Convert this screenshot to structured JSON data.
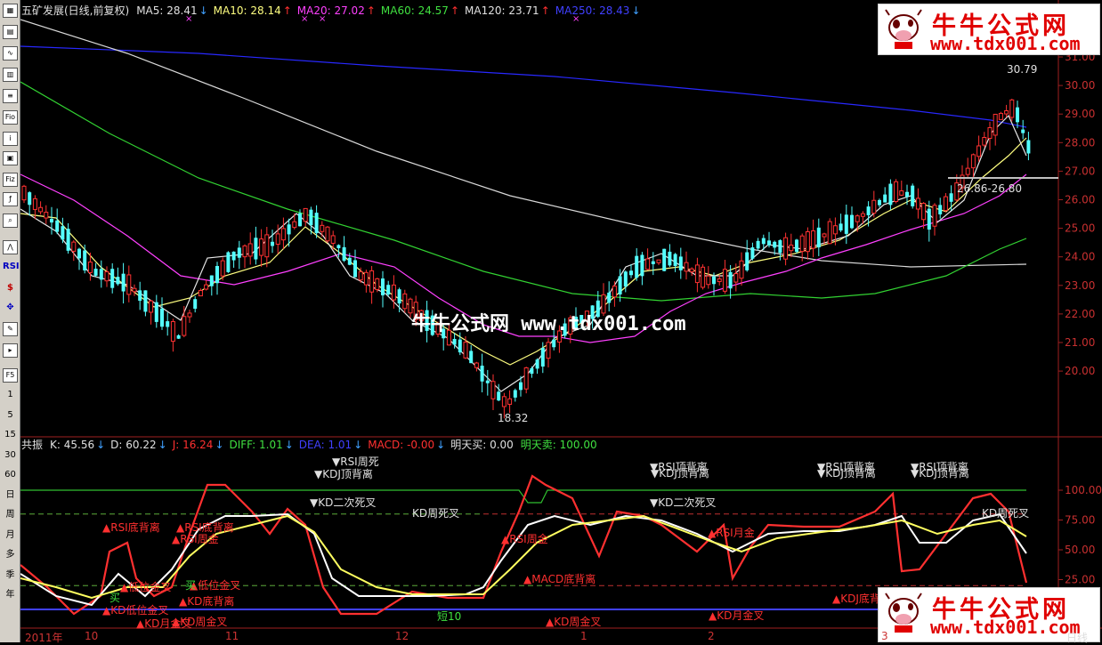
{
  "main_legend": [
    {
      "text": "五矿发展(日线,前复权)",
      "color": "#e0e0e0"
    },
    {
      "text": "MA5: 28.41",
      "color": "#e0e0e0",
      "arrow": "↓",
      "arrow_color": "#40a0ff"
    },
    {
      "text": "MA10: 28.14",
      "color": "#ffff80",
      "arrow": "↑",
      "arrow_color": "#ff3030"
    },
    {
      "text": "MA20: 27.02",
      "color": "#ff40ff",
      "arrow": "↑",
      "arrow_color": "#ff3030"
    },
    {
      "text": "MA60: 24.57",
      "color": "#40e040",
      "arrow": "↑",
      "arrow_color": "#ff3030"
    },
    {
      "text": "MA120: 23.71",
      "color": "#e0e0e0",
      "arrow": "↑",
      "arrow_color": "#ff3030"
    },
    {
      "text": "MA250: 28.43",
      "color": "#4040ff",
      "arrow": "↓",
      "arrow_color": "#40a0ff"
    }
  ],
  "sub_legend": [
    {
      "text": "共振",
      "color": "#e0e0e0"
    },
    {
      "text": "K: 45.56",
      "color": "#e0e0e0",
      "arrow": "↓",
      "arrow_color": "#40a0ff"
    },
    {
      "text": "D: 60.22",
      "color": "#e0e0e0",
      "arrow": "↓",
      "arrow_color": "#40a0ff"
    },
    {
      "text": "J: 16.24",
      "color": "#ff3030",
      "arrow": "↓",
      "arrow_color": "#40a0ff"
    },
    {
      "text": "DIFF: 1.01",
      "color": "#40e040",
      "arrow": "↓",
      "arrow_color": "#40a0ff"
    },
    {
      "text": "DEA: 1.01",
      "color": "#4040ff",
      "arrow": "↓",
      "arrow_color": "#40a0ff"
    },
    {
      "text": "MACD: -0.00",
      "color": "#ff3030",
      "arrow": "↓",
      "arrow_color": "#40a0ff"
    },
    {
      "text": "明天买: 0.00",
      "color": "#e0e0e0"
    },
    {
      "text": "明天卖: 100.00",
      "color": "#40e040"
    }
  ],
  "price_axis": [
    "31.00",
    "30.00",
    "29.00",
    "28.00",
    "27.00",
    "26.00",
    "25.00",
    "24.00",
    "23.00",
    "22.00",
    "21.00",
    "20.00"
  ],
  "indicator_axis": [
    "100.00",
    "75.00",
    "50.00",
    "25.00"
  ],
  "date_labels": [
    "2011年",
    "10",
    "11",
    "12",
    "1",
    "2",
    "3"
  ],
  "axis_corner_label": "日线",
  "toolbar_labels": [
    "Fio",
    "Fiz",
    "RSI",
    "F5",
    "1",
    "5",
    "15",
    "30",
    "60",
    "日",
    "周",
    "月",
    "多",
    "季",
    "年"
  ],
  "price_annotations": {
    "high": "30.79",
    "low": "18.32",
    "range": "26.86-26.80"
  },
  "signals_white": [
    {
      "text": "▼RSI周死"
    },
    {
      "text": "▼KDJ顶背离"
    },
    {
      "text": "▼KD二次死叉"
    },
    {
      "text": "KD周死叉"
    },
    {
      "text": "▼RSI顶背离"
    },
    {
      "text": "▼KDJ顶背离"
    },
    {
      "text": "▼KD二次死叉"
    },
    {
      "text": "▼RSI顶背离"
    },
    {
      "text": "▼KDJ顶背离"
    },
    {
      "text": "▼RSI顶背离"
    },
    {
      "text": "▼KDJ顶背离"
    },
    {
      "text": "KD周死叉"
    }
  ],
  "signals_red": [
    {
      "text": "▲RSI底背离"
    },
    {
      "text": "▲RSI底背离"
    },
    {
      "text": "▲RSI周金"
    },
    {
      "text": "▲RSI周金"
    },
    {
      "text": "▲RSI月金"
    },
    {
      "text": "▲MACD底背离"
    },
    {
      "text": "▲低位金叉"
    },
    {
      "text": "▲低位金叉"
    },
    {
      "text": "▲KD低位金叉"
    },
    {
      "text": "▲KD底背离"
    },
    {
      "text": "▲KD周金叉"
    },
    {
      "text": "▲KD月金叉"
    },
    {
      "text": "▲KDJ底背"
    },
    {
      "text": "▲KD周金叉"
    },
    {
      "text": "▲KD月金叉"
    }
  ],
  "signals_green": [
    {
      "text": "买"
    },
    {
      "text": "买"
    },
    {
      "text": "短10"
    }
  ],
  "watermark": {
    "brand": "牛牛公式网",
    "url": "www.tdx001.com",
    "center": "牛牛公式网 www.tdx001.com"
  },
  "colors": {
    "up": "#ff3232",
    "down": "#54ffff",
    "ma5": "#e6e6e6",
    "ma10": "#ffff80",
    "ma20": "#ff40ff",
    "ma60": "#32d232",
    "ma120": "#d8d8d8",
    "ma250": "#2828ff"
  }
}
